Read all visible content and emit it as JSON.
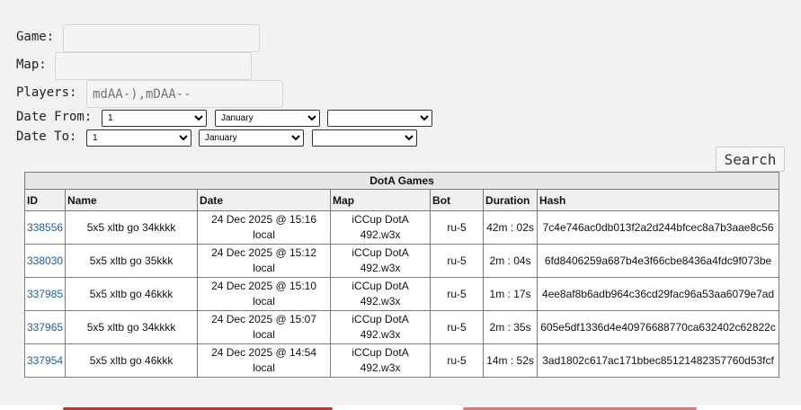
{
  "form": {
    "game_label": "Game:",
    "game_value": "",
    "map_label": "Map:",
    "map_value": "",
    "players_label": "Players:",
    "players_placeholder": "mdAA-),mDAA--",
    "date_from_label": "Date From:",
    "date_to_label": "Date To:",
    "date_from": {
      "day": "1",
      "month": "January",
      "year": ""
    },
    "date_to": {
      "day": "1",
      "month": "January",
      "year": ""
    },
    "search_label": "Search"
  },
  "table": {
    "caption": "DotA Games",
    "columns": [
      "ID",
      "Name",
      "Date",
      "Map",
      "Bot",
      "Duration",
      "Hash"
    ],
    "rows": [
      {
        "id": "338556",
        "name": "5x5 xltb go 34kkkk",
        "date": "24 Dec 2025 @ 15:16 local",
        "map1": "iCCup DotA",
        "map2": "492.w3x",
        "bot": "ru-5",
        "duration": "42m : 02s",
        "hash": "7c4e746ac0db013f2a2d244bfcec8a7b3aae8c56"
      },
      {
        "id": "338030",
        "name": "5x5 xltb go 35kkk",
        "date": "24 Dec 2025 @ 15:12 local",
        "map1": "iCCup DotA",
        "map2": "492.w3x",
        "bot": "ru-5",
        "duration": "2m : 04s",
        "hash": "6fd8406259a687b4e3f66cbe8436a4fdc9f073be"
      },
      {
        "id": "337985",
        "name": "5x5 xltb go 46kkk",
        "date": "24 Dec 2025 @ 15:10 local",
        "map1": "iCCup DotA",
        "map2": "492.w3x",
        "bot": "ru-5",
        "duration": "1m : 17s",
        "hash": "4ee8af8b6adb964c36cd29fac96a53aa6079e7ad"
      },
      {
        "id": "337965",
        "name": "5x5 xltb go 34kkkk",
        "date": "24 Dec 2025 @ 15:07 local",
        "map1": "iCCup DotA",
        "map2": "492.w3x",
        "bot": "ru-5",
        "duration": "2m : 35s",
        "hash": "605e5df1336d4e40976688770ca632402c62822c"
      },
      {
        "id": "337954",
        "name": "5x5 xltb go 46kkk",
        "date": "24 Dec 2025 @ 14:54 local",
        "map1": "iCCup DotA",
        "map2": "492.w3x",
        "bot": "ru-5",
        "duration": "14m : 52s",
        "hash": "3ad1802c617ac171bbec85121482357760d53fcf"
      }
    ]
  },
  "colors": {
    "page_bg": "#f2f2f2",
    "link": "#1a5fa6",
    "header_bg": "#e6e6e6",
    "border": "#7a7a7a"
  }
}
